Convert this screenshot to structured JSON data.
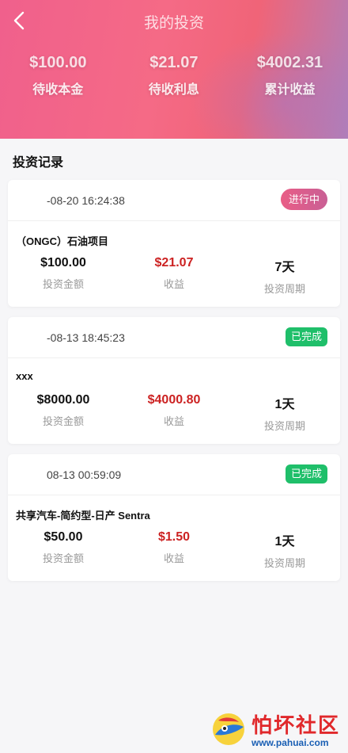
{
  "header": {
    "title": "我的投资",
    "stats": [
      {
        "value": "$100.00",
        "label": "待收本金"
      },
      {
        "value": "$21.07",
        "label": "待收利息"
      },
      {
        "value": "$4002.31",
        "label": "累计收益"
      }
    ]
  },
  "section_title": "投资记录",
  "records": [
    {
      "time": "-08-20 16:24:38",
      "status": "进行中",
      "name": "（ONGC）石油项目",
      "amount": "$100.00",
      "amount_label": "投资金额",
      "profit": "$21.07",
      "profit_label": "收益",
      "period": "7天",
      "period_label": "投资周期"
    },
    {
      "time": "-08-13 18:45:23",
      "status": "已完成",
      "name": "xxx",
      "amount": "$8000.00",
      "amount_label": "投资金额",
      "profit": "$4000.80",
      "profit_label": "收益",
      "period": "1天",
      "period_label": "投资周期"
    },
    {
      "time": "08-13 00:59:09",
      "status": "已完成",
      "name": "共享汽车-简约型-日产 Sentra",
      "amount": "$50.00",
      "amount_label": "投资金额",
      "profit": "$1.50",
      "profit_label": "收益",
      "period": "1天",
      "period_label": "投资周期"
    }
  ],
  "watermark": {
    "title": "怕坏社区",
    "url": "www.pahuai.com"
  },
  "colors": {
    "accent": "#f0608c",
    "running_badge": "#e95e86",
    "done_badge": "#1fbf6a",
    "profit": "#cc2222"
  },
  "icons": {
    "back": "chevron-left-icon"
  }
}
